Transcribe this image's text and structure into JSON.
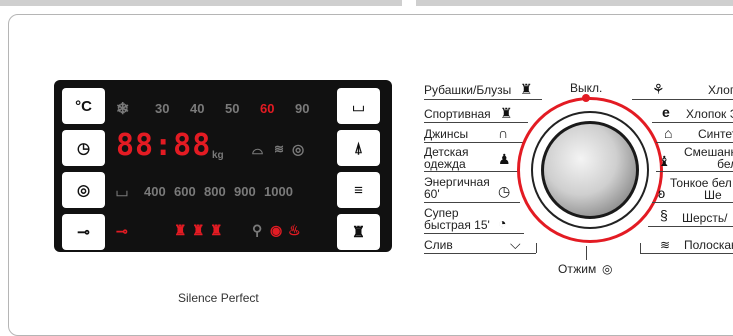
{
  "panel": {
    "left_buttons": [
      {
        "label": "°C"
      },
      {
        "label": "◷"
      },
      {
        "label": "◎"
      },
      {
        "label": "⊸"
      }
    ],
    "right_buttons": [
      {
        "label": "⌴"
      },
      {
        "label": "⍋"
      },
      {
        "label": "≡"
      },
      {
        "label": "♜"
      }
    ],
    "temps": [
      "30",
      "40",
      "50",
      "60",
      "90"
    ],
    "active_temp": "60",
    "time_digits": "88:88",
    "kg_label": "kg",
    "spins": [
      "400",
      "600",
      "800",
      "900",
      "1000"
    ],
    "colors": {
      "accent": "#e31b23",
      "lcd_bg": "#111111",
      "lcd_dim": "#7a7a7a"
    }
  },
  "brand_line": "Silence Perfect",
  "dial": {
    "top_label": "Выкл.",
    "bottom_label": "Отжим",
    "left_programs": [
      {
        "label": "Рубашки/Блузы"
      },
      {
        "label": "Спортивная"
      },
      {
        "label": "Джинсы"
      },
      {
        "label": "Детская одежда",
        "l1": "Детская",
        "l2": "одежда"
      },
      {
        "label": "Энергичная 60'",
        "l1": "Энергичная",
        "l2": "60'"
      },
      {
        "label": "Супер быстрая 15'",
        "l1": "Супер",
        "l2": "быстрая 15'"
      },
      {
        "label": "Слив"
      }
    ],
    "right_programs": [
      {
        "label": "Хлоп"
      },
      {
        "label": "Хлопок Э"
      },
      {
        "label": "Синтет"
      },
      {
        "label": "Смешан бел",
        "l1": "Смешанн",
        "l2": "бел"
      },
      {
        "label": "Тонкое бел Ше",
        "l1": "Тонкое бел",
        "l2": "Ше"
      },
      {
        "label": "Шерсть/"
      },
      {
        "label": "Полоскан"
      }
    ]
  }
}
